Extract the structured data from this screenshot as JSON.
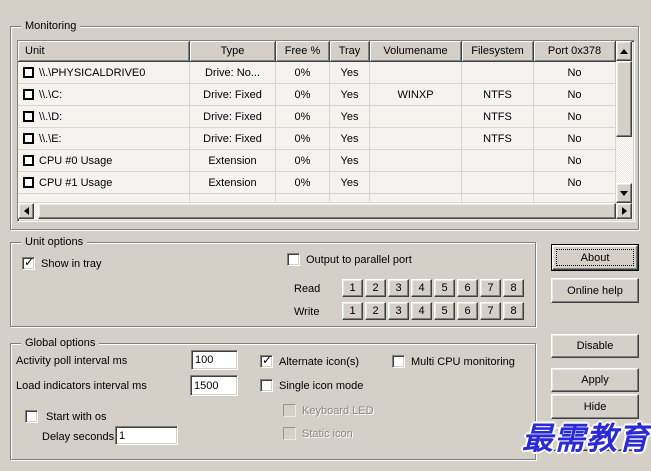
{
  "colors": {
    "dialog_bg": "#d4d0c8",
    "table_row_bg": "#f4f3f0",
    "watermark_blue": "#2b2bd5"
  },
  "monitoring": {
    "label": "Monitoring",
    "table": {
      "headers": [
        "Unit",
        "Type",
        "Free %",
        "Tray",
        "Volumename",
        "Filesystem",
        "Port 0x378"
      ],
      "rows": [
        {
          "unit": "\\\\.\\PHYSICALDRIVE0",
          "type": "Drive: No...",
          "free": "0%",
          "tray": "Yes",
          "volume": "",
          "fs": "",
          "port": "No",
          "checked": false
        },
        {
          "unit": "\\\\.\\C:",
          "type": "Drive: Fixed",
          "free": "0%",
          "tray": "Yes",
          "volume": "WINXP",
          "fs": "NTFS",
          "port": "No",
          "checked": false
        },
        {
          "unit": "\\\\.\\D:",
          "type": "Drive: Fixed",
          "free": "0%",
          "tray": "Yes",
          "volume": "",
          "fs": "NTFS",
          "port": "No",
          "checked": false
        },
        {
          "unit": "\\\\.\\E:",
          "type": "Drive: Fixed",
          "free": "0%",
          "tray": "Yes",
          "volume": "",
          "fs": "NTFS",
          "port": "No",
          "checked": false
        },
        {
          "unit": "CPU #0 Usage",
          "type": "Extension",
          "free": "0%",
          "tray": "Yes",
          "volume": "",
          "fs": "",
          "port": "No",
          "checked": false
        },
        {
          "unit": "CPU #1 Usage",
          "type": "Extension",
          "free": "0%",
          "tray": "Yes",
          "volume": "",
          "fs": "",
          "port": "No",
          "checked": false
        }
      ]
    }
  },
  "unit_options": {
    "label": "Unit options",
    "show_in_tray": {
      "label": "Show in tray",
      "checked": true
    },
    "output_parallel": {
      "label": "Output to parallel port",
      "checked": false
    },
    "read_label": "Read",
    "write_label": "Write",
    "port_buttons": [
      "1",
      "2",
      "3",
      "4",
      "5",
      "6",
      "7",
      "8"
    ]
  },
  "global_options": {
    "label": "Global options",
    "activity_poll": {
      "label": "Activity poll interval ms",
      "value": "100"
    },
    "load_indicators": {
      "label": "Load indicators interval ms",
      "value": "1500"
    },
    "start_with_os": {
      "label": "Start with os",
      "checked": false
    },
    "delay_seconds": {
      "label": "Delay seconds",
      "value": "1"
    },
    "alternate_icons": {
      "label": "Alternate icon(s)",
      "checked": true
    },
    "multi_cpu": {
      "label": "Multi CPU monitoring",
      "checked": false
    },
    "single_icon": {
      "label": "Single icon mode",
      "checked": false
    },
    "keyboard_led": {
      "label": "Keyboard LED",
      "checked": false,
      "disabled": true
    },
    "static_icon": {
      "label": "Static icon",
      "checked": false,
      "disabled": true
    }
  },
  "buttons": {
    "about": "About",
    "online_help": "Online help",
    "disable": "Disable",
    "apply": "Apply",
    "hide": "Hide"
  },
  "watermark": {
    "text": "最需教育"
  }
}
